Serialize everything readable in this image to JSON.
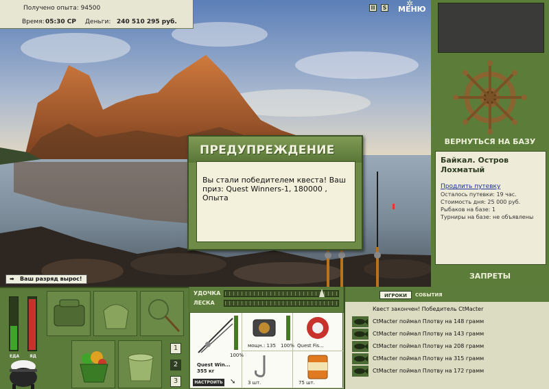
{
  "hud": {
    "experience_label": "Получено опыта:",
    "experience_value": "94500",
    "time_label": "Время:",
    "time_value": "05:30 СР",
    "money_label": "Деньги:",
    "money_value": "240 510 295 руб."
  },
  "top_icons": {
    "pause_glyph": "II",
    "sound_glyph": "S",
    "menu_label": "МЕНЮ"
  },
  "notification": {
    "rank_up": "Ваш разряд вырос!"
  },
  "dialog": {
    "title": "ПРЕДУПРЕЖДЕНИЕ",
    "message": "Вы стали победителем квеста! Ваш приз: Quest Winners-1, 180000 , Опыта"
  },
  "base_panel": {
    "return_label": "ВЕРНУТЬСЯ НА БАЗУ",
    "location": "Байкал. Остров Лохматый",
    "extend_link": "Продлить путевку",
    "lines": [
      "Осталось путевки: 19 час.",
      "Стоимость дня: 25 000 руб.",
      "Рыбаков на базе: 1",
      "Турниры на базе: не объявлены"
    ],
    "bans_label": "ЗАПРЕТЫ"
  },
  "status": {
    "food_label": "ЕДА",
    "poison_label": "ЯД",
    "food_level": 0.45,
    "poison_level": 0.95
  },
  "inventory_tabs": [
    "1",
    "2",
    "3"
  ],
  "active_inventory_tab": 1,
  "tackle": {
    "rod_label": "УДОЧКА",
    "line_label": "ЛЕСКА",
    "rod_name": "Quest Win...",
    "rod_weight": "355 кг",
    "rod_condition": "100%",
    "reel_power": "мощн.: 135",
    "reel_condition": "100%",
    "line_name": "Quest Fis...",
    "hook_count": "3 шт.",
    "bait_count": "75 шт.",
    "setup_label": "НАСТРОИТЬ",
    "rod_level": 1.0,
    "reel_level": 1.0
  },
  "feed": {
    "tabs": [
      "ИГРОКИ",
      "СОБЫТИЯ"
    ],
    "quest_done": "Квест закончен! Победитель CtMacter",
    "events": [
      "CtMacter поймал Плотву на 148 грамм",
      "CtMacter поймал Плотву на 143 грамм",
      "CtMacter поймал Плотву на 208 грамм",
      "CtMacter поймал Плотву на 315 грамм",
      "CtMacter поймал Плотву на 172 грамм"
    ]
  },
  "colors": {
    "frame_green": "#5c7c3a",
    "panel_cream": "#eeecd8",
    "food_green": "#3fa52a",
    "poison_red": "#c8322c"
  }
}
